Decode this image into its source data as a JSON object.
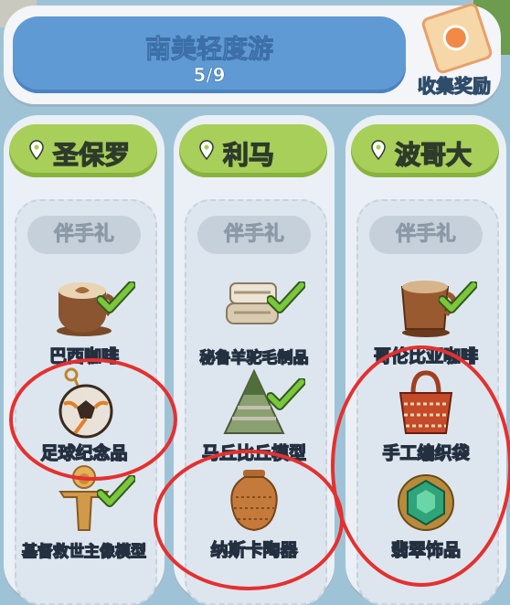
{
  "header": {
    "title": "南美轻度游",
    "progress": "5/9"
  },
  "reward": {
    "label": "收集奖励"
  },
  "gift_label": "伴手礼",
  "columns": [
    {
      "name": "圣保罗",
      "items": [
        {
          "label": "巴西咖啡",
          "collected": true
        },
        {
          "label": "足球纪念品",
          "collected": false
        },
        {
          "label": "基督救世主像模型",
          "collected": true
        }
      ]
    },
    {
      "name": "利马",
      "items": [
        {
          "label": "秘鲁羊驼毛制品",
          "collected": true
        },
        {
          "label": "马丘比丘模型",
          "collected": true
        },
        {
          "label": "纳斯卡陶器",
          "collected": false
        }
      ]
    },
    {
      "name": "波哥大",
      "items": [
        {
          "label": "哥伦比亚咖啡",
          "collected": true
        },
        {
          "label": "手工编织袋",
          "collected": false
        },
        {
          "label": "翡翠饰品",
          "collected": false
        }
      ]
    }
  ],
  "colors": {
    "header_blue": "#5f9ad4",
    "tab_green": "#a8cf5a",
    "check_green": "#7cc63c",
    "highlight_red": "#e53030"
  },
  "icons": {
    "pin": "location-pin-icon",
    "check": "checkmark-icon",
    "coffee": "coffee-cup-icon",
    "football": "football-keychain-icon",
    "statue": "christ-statue-icon",
    "alpaca": "alpaca-wool-icon",
    "machu": "machu-picchu-icon",
    "pottery": "nazca-pottery-icon",
    "bag": "woven-bag-icon",
    "emerald": "emerald-ring-icon",
    "reward": "reward-ticket-icon"
  }
}
